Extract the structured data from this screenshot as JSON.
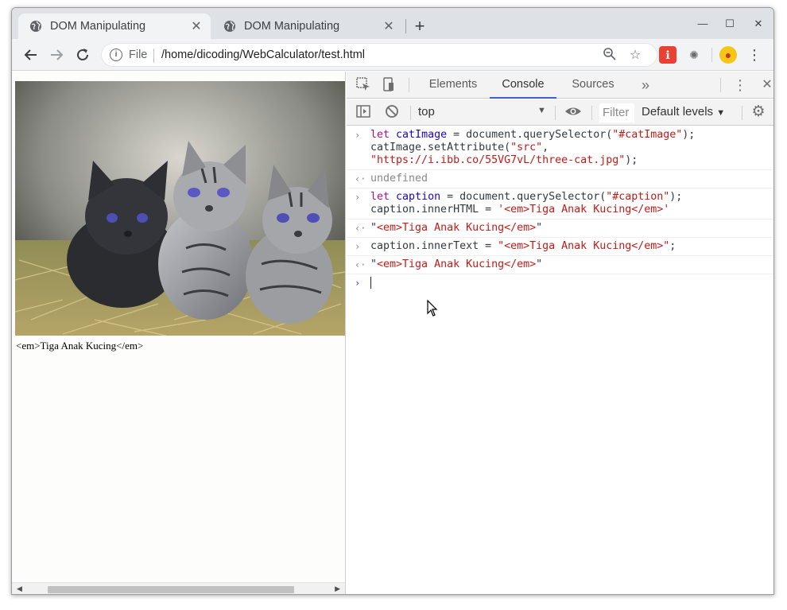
{
  "tabs": [
    {
      "title": "DOM Manipulating",
      "active": true
    },
    {
      "title": "DOM Manipulating",
      "active": false
    }
  ],
  "toolbar": {
    "file_label": "File",
    "url": "/home/dicoding/WebCalculator/test.html"
  },
  "page": {
    "image_alt": "three kittens",
    "caption": "<em>Tiga Anak Kucing</em>"
  },
  "devtools": {
    "tabs": [
      "Elements",
      "Console",
      "Sources"
    ],
    "active_tab": "Console",
    "context": "top",
    "filter_placeholder": "Filter",
    "levels": "Default levels"
  },
  "console": {
    "e1_kw": "let",
    "e1_var": "catImage",
    "e1_mid": " = document.querySelector(",
    "e1_str": "\"#catImage\"",
    "e1_end": ");",
    "e1_l2": "catImage.setAttribute(",
    "e1_l2_str": "\"src\"",
    "e1_l2_end": ",",
    "e1_l3_str": "\"https://i.ibb.co/55VG7vL/three-cat.jpg\"",
    "e1_l3_end": ");",
    "r1": "undefined",
    "e2_kw": "let",
    "e2_var": "caption",
    "e2_mid": " = document.querySelector(",
    "e2_str": "\"#caption\"",
    "e2_end": ");",
    "e2_l2": "caption.innerHTML = ",
    "e2_l2_str": "'<em>Tiga Anak Kucing</em>'",
    "r2_q1": "\"",
    "r2_str": "<em>Tiga Anak Kucing</em>",
    "r2_q2": "\"",
    "e3": "caption.innerText = ",
    "e3_str": "\"<em>Tiga Anak Kucing</em>\"",
    "e3_end": ";",
    "r3_q1": "\"",
    "r3_str": "<em>Tiga Anak Kucing</em>",
    "r3_q2": "\""
  },
  "icons": {
    "tab_favicon": "globe-icon",
    "back": "arrow-left-icon",
    "forward": "arrow-right-icon",
    "reload": "reload-icon",
    "info": "info-icon",
    "zoom": "zoom-icon",
    "bookmark": "star-icon",
    "menu": "kebab-menu-icon"
  }
}
